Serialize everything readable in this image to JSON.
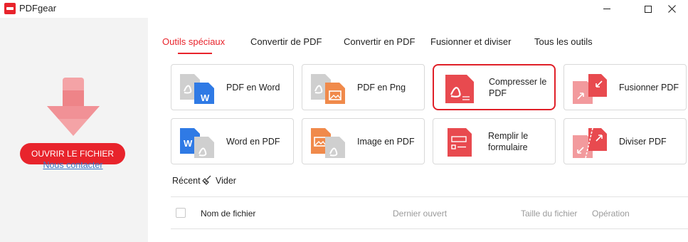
{
  "window": {
    "title": "PDFgear",
    "icons": {
      "logo": "pdfgear-logo",
      "minimize": "minimize-icon",
      "maximize": "maximize-icon",
      "close": "close-icon"
    }
  },
  "sidebar": {
    "open_button": "OUVRIR LE FICHIER",
    "contact_link": "Nous contacter",
    "icon": "download-arrow-icon"
  },
  "tabs": [
    {
      "label": "Outils spéciaux",
      "active": true
    },
    {
      "label": "Convertir de PDF"
    },
    {
      "label": "Convertir en PDF"
    },
    {
      "label": "Fusionner et diviser"
    },
    {
      "label": "Tous les outils"
    }
  ],
  "tools": [
    {
      "label": "PDF en Word",
      "icon": "pdf-to-word-icon"
    },
    {
      "label": "PDF en Png",
      "icon": "pdf-to-png-icon"
    },
    {
      "label": "Compresser le PDF",
      "icon": "compress-pdf-icon",
      "selected": true
    },
    {
      "label": "Fusionner PDF",
      "icon": "merge-pdf-icon"
    },
    {
      "label": "Word en PDF",
      "icon": "word-to-pdf-icon"
    },
    {
      "label": "Image en PDF",
      "icon": "image-to-pdf-icon"
    },
    {
      "label": "Remplir le formulaire",
      "icon": "fill-form-icon"
    },
    {
      "label": "Diviser PDF",
      "icon": "split-pdf-icon"
    }
  ],
  "recent": {
    "label": "Récent",
    "clear_label": "Vider",
    "columns": {
      "name": "Nom de fichier",
      "last_opened": "Dernier ouvert",
      "size": "Taille du fichier",
      "operation": "Opération"
    }
  },
  "colors": {
    "accent": "#e8242c",
    "link": "#3a78c9",
    "sidebar_bg": "#f3f3f3",
    "word_blue": "#2f7ae5",
    "image_orange": "#f08a4b"
  }
}
